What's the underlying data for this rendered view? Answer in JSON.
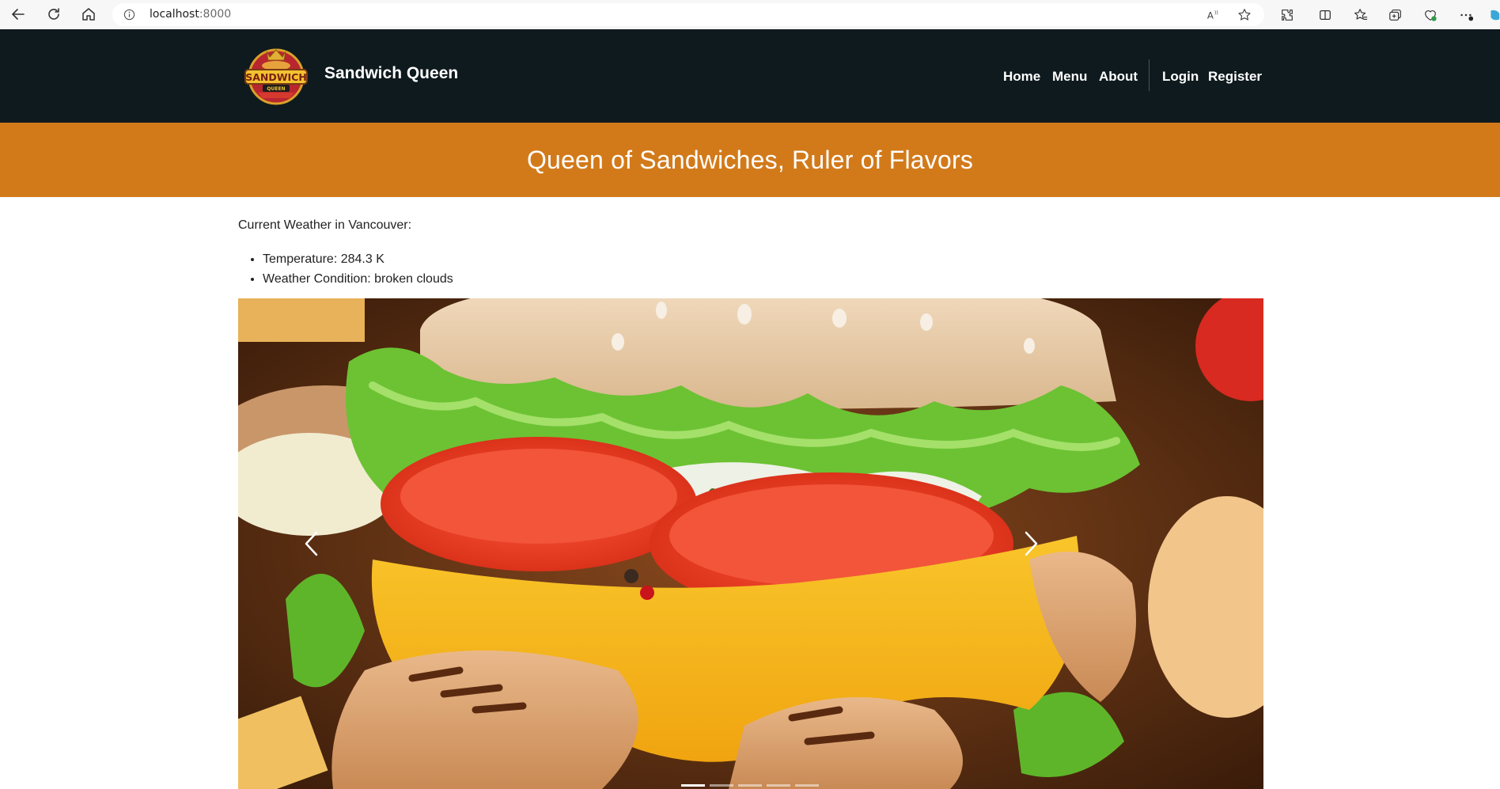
{
  "browser": {
    "url_host": "localhost",
    "url_port": ":8000"
  },
  "header": {
    "brand": "Sandwich Queen",
    "logo_text_top": "SANDWICH",
    "logo_text_bottom": "QUEEN",
    "nav": [
      {
        "label": "Home"
      },
      {
        "label": "Menu"
      },
      {
        "label": "About"
      },
      {
        "label": "Login"
      },
      {
        "label": "Register"
      }
    ]
  },
  "hero": {
    "title": "Queen of Sandwiches, Ruler of Flavors"
  },
  "weather": {
    "heading": "Current Weather in Vancouver:",
    "items": [
      "Temperature: 284.3 K",
      "Weather Condition: broken clouds"
    ]
  },
  "carousel": {
    "slide_count": 5,
    "active_index": 0
  },
  "colors": {
    "header_bg": "#0f1a1e",
    "hero_bg": "#d27a1a"
  }
}
